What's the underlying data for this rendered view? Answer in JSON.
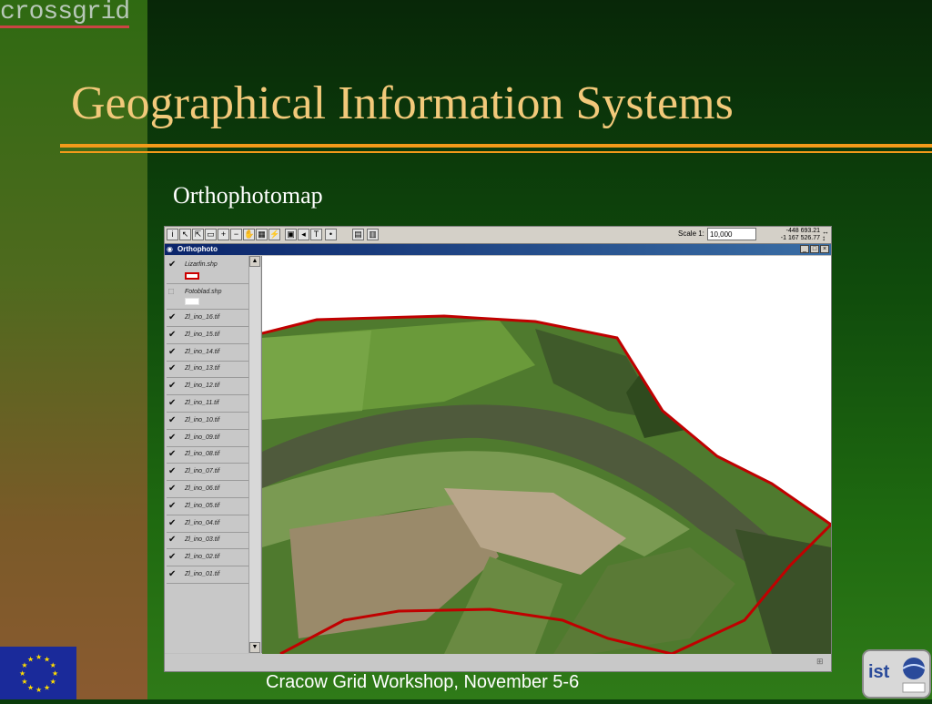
{
  "slide": {
    "logo_text": "crossgrid",
    "title": "Geographical Information Systems",
    "subtitle": "Orthophotomap",
    "footer": "Cracow Grid Workshop, November 5-6"
  },
  "app": {
    "scale_label": "Scale 1:",
    "scale_value": "10,000",
    "coord_x": "-448 693.21",
    "coord_y": "-1 167 526.77",
    "window_title": "Orthophoto",
    "window_controls": [
      "_",
      "□",
      "×"
    ]
  },
  "legend": {
    "items": [
      {
        "label": "Lizarfin.shp",
        "checked": true
      },
      {
        "label": "Fotoblad.shp",
        "checked": false
      },
      {
        "label": "Zl_ino_16.tif",
        "checked": true
      },
      {
        "label": "Zl_ino_15.tif",
        "checked": true
      },
      {
        "label": "Zl_ino_14.tif",
        "checked": true
      },
      {
        "label": "Zl_ino_13.tif",
        "checked": true
      },
      {
        "label": "Zl_ino_12.tif",
        "checked": true
      },
      {
        "label": "Zl_ino_11.tif",
        "checked": true
      },
      {
        "label": "Zl_ino_10.tif",
        "checked": true
      },
      {
        "label": "Zl_ino_09.tif",
        "checked": true
      },
      {
        "label": "Zl_ino_08.tif",
        "checked": true
      },
      {
        "label": "Zl_ino_07.tif",
        "checked": true
      },
      {
        "label": "Zl_ino_06.tif",
        "checked": true
      },
      {
        "label": "Zl_ino_05.tif",
        "checked": true
      },
      {
        "label": "Zl_ino_04.tif",
        "checked": true
      },
      {
        "label": "Zl_ino_03.tif",
        "checked": true
      },
      {
        "label": "Zl_ino_02.tif",
        "checked": true
      },
      {
        "label": "Zl_ino_01.tif",
        "checked": true
      }
    ]
  },
  "colors": {
    "title": "#f2c97a",
    "rule": "#f39a1a",
    "boundary": "#c00000",
    "river": "#4f5a3c"
  }
}
